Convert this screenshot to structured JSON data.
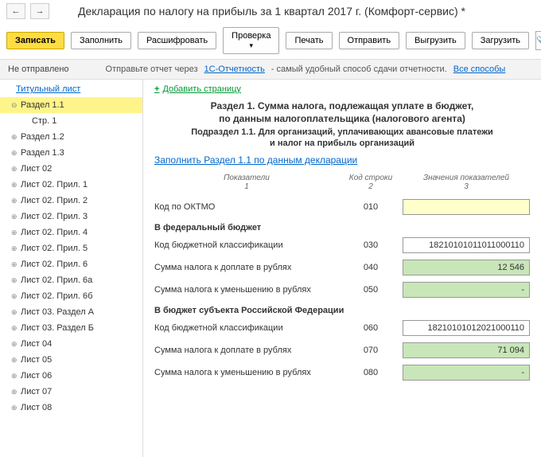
{
  "header": {
    "title": "Декларация по налогу на прибыль за 1 квартал 2017 г. (Комфорт-сервис) *"
  },
  "toolbar": {
    "save": "Записать",
    "fill": "Заполнить",
    "decrypt": "Расшифровать",
    "check": "Проверка",
    "print": "Печать",
    "send": "Отправить",
    "export": "Выгрузить",
    "load": "Загрузить"
  },
  "status": {
    "state": "Не отправлено",
    "hint1": "Отправьте отчет через",
    "hint_link": "1С-Отчетность",
    "hint2": " - самый удобный способ сдачи отчетности.",
    "all_ways": "Все способы"
  },
  "tree": {
    "title_page": "Титульный лист",
    "items": [
      "Раздел 1.1",
      "Стр. 1",
      "Раздел 1.2",
      "Раздел 1.3",
      "Лист 02",
      "Лист 02. Прил. 1",
      "Лист 02. Прил. 2",
      "Лист 02. Прил. 3",
      "Лист 02. Прил. 4",
      "Лист 02. Прил. 5",
      "Лист 02. Прил. 6",
      "Лист 02. Прил. 6а",
      "Лист 02. Прил. 6б",
      "Лист 03. Раздел А",
      "Лист 03. Раздел Б",
      "Лист 04",
      "Лист 05",
      "Лист 06",
      "Лист 07",
      "Лист 08"
    ]
  },
  "content": {
    "add_page": "Добавить страницу",
    "title_line1": "Раздел 1. Сумма налога, подлежащая уплате в бюджет,",
    "title_line2": "по данным налогоплательщика (налогового агента)",
    "sub1": "Подраздел 1.1. Для организаций, уплачивающих авансовые платежи",
    "sub2": "и налог на прибыль организаций",
    "fill_link": "Заполнить Раздел 1.1 по данным декларации",
    "cols": {
      "c1a": "Показатели",
      "c1b": "1",
      "c2a": "Код строки",
      "c2b": "2",
      "c3a": "Значения показателей",
      "c3b": "3"
    },
    "rows": {
      "oktmo_lbl": "Код по ОКТМО",
      "oktmo_code": "010",
      "oktmo_val": "",
      "fed_head": "В федеральный бюджет",
      "kbk1_lbl": "Код бюджетной классификации",
      "kbk1_code": "030",
      "kbk1_val": "18210101011011000110",
      "sum1_lbl": "Сумма налога к доплате в рублях",
      "sum1_code": "040",
      "sum1_val": "12 546",
      "red1_lbl": "Сумма налога к уменьшению в рублях",
      "red1_code": "050",
      "red1_val": "-",
      "sub_head": "В бюджет субъекта Российской Федерации",
      "kbk2_lbl": "Код бюджетной классификации",
      "kbk2_code": "060",
      "kbk2_val": "18210101012021000110",
      "sum2_lbl": "Сумма налога к доплате в рублях",
      "sum2_code": "070",
      "sum2_val": "71 094",
      "red2_lbl": "Сумма налога к уменьшению в рублях",
      "red2_code": "080",
      "red2_val": "-"
    }
  }
}
